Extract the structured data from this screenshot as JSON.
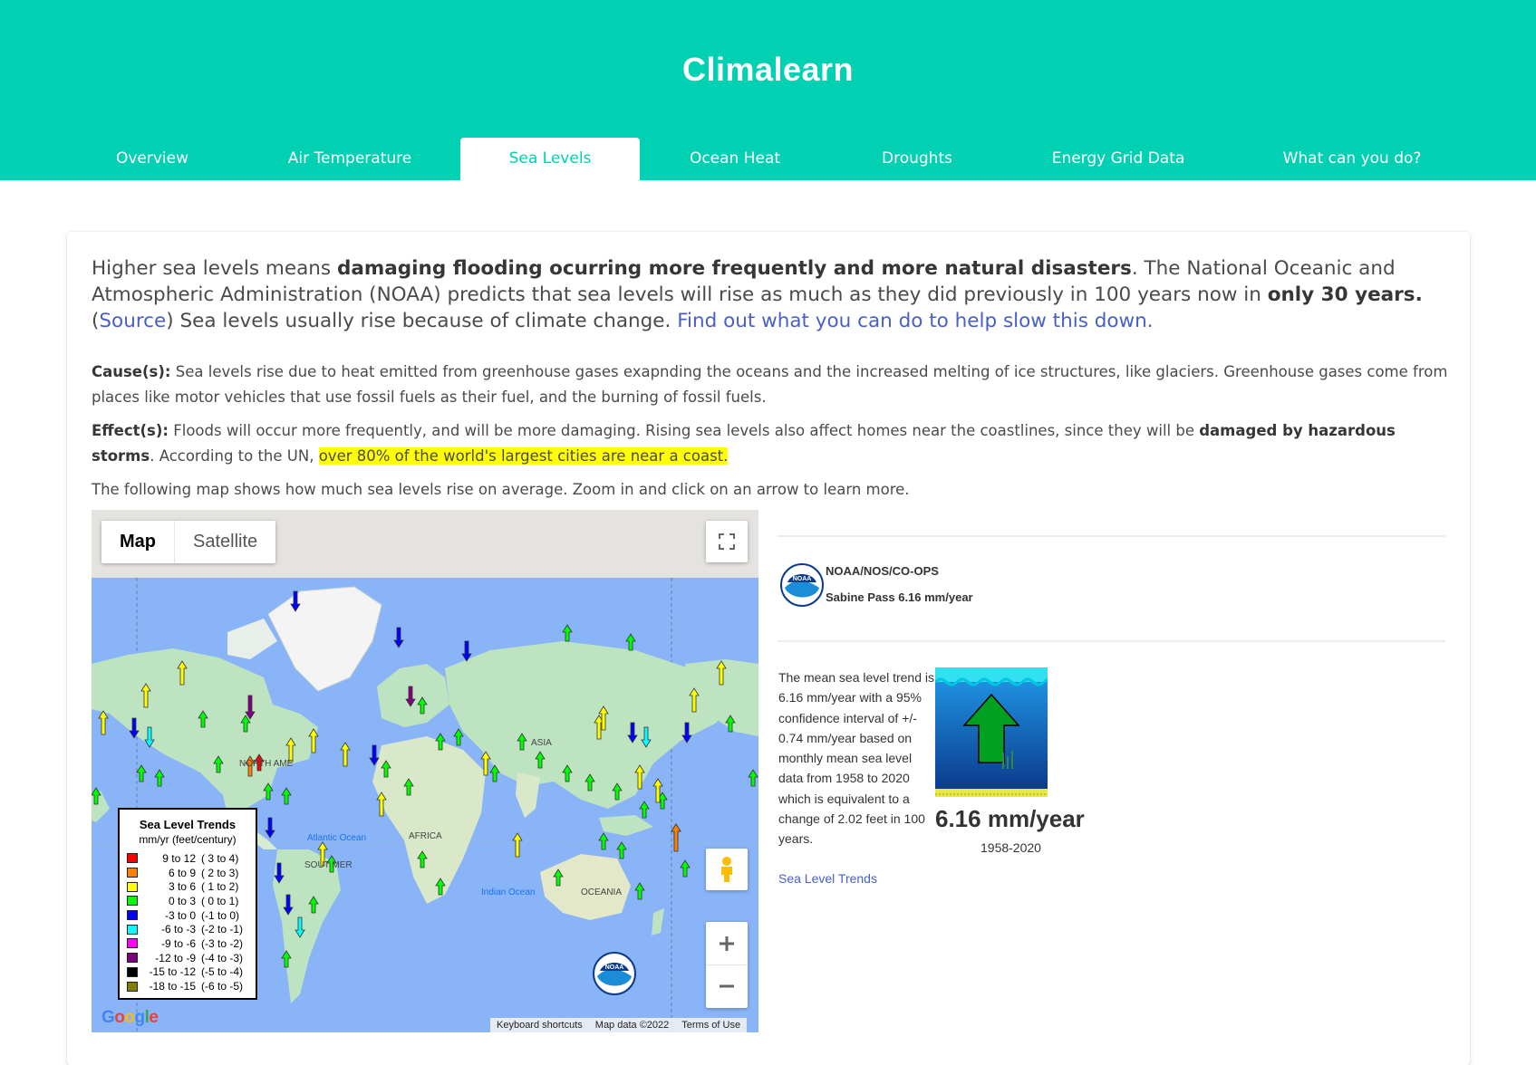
{
  "header": {
    "title": "Climalearn",
    "tabs": [
      {
        "label": "Overview",
        "active": false
      },
      {
        "label": "Air Temperature",
        "active": false
      },
      {
        "label": "Sea Levels",
        "active": true
      },
      {
        "label": "Ocean Heat",
        "active": false
      },
      {
        "label": "Droughts",
        "active": false
      },
      {
        "label": "Energy Grid Data",
        "active": false
      },
      {
        "label": "What can you do?",
        "active": false
      }
    ]
  },
  "lead": {
    "t1": "Higher sea levels means ",
    "b1": "damaging flooding ocurring more frequently and more natural disasters",
    "t2": ". The National Oceanic and Atmospheric Administration (NOAA) predicts that sea levels will rise as much as they did previously in 100 years now in ",
    "b2": "only 30 years.",
    "t3": " (",
    "source_link": "Source",
    "t4": ") Sea levels usually rise because of climate change. ",
    "help_link": "Find out what you can do to help slow this down."
  },
  "causes": {
    "label": "Cause(s):",
    "text": " Sea levels rise due to heat emitted from greenhouse gases exapnding the oceans and the increased melting of ice structures, like glaciers. Greenhouse gases come from places like motor vehicles that use fossil fuels as their fuel, and the burning of fossil fuels."
  },
  "effects": {
    "label": "Effect(s):",
    "t1": " Floods will occur more frequently, and will be more damaging. Rising sea levels also affect homes near the coastlines, since they will be ",
    "b1": "damaged by hazardous storms",
    "t2": ". According to the UN, ",
    "highlight": "over 80% of the world's largest cities are near a coast."
  },
  "map_intro": "The following map shows how much sea levels rise on average. Zoom in and click on an arrow to learn more.",
  "map": {
    "type_map": "Map",
    "type_satellite": "Satellite",
    "labels": {
      "north_america": "NORTH AME",
      "south_america": "SOUT MER",
      "africa": "AFRICA",
      "asia": "ASIA",
      "oceania": "OCEANIA",
      "atlantic": "Atlantic Ocean",
      "indian": "Indian Ocean"
    },
    "legend": {
      "title": "Sea Level Trends",
      "subtitle": "mm/yr (feet/century)",
      "rows": [
        {
          "range": "9 to  12",
          "feet": "( 3 to  4)",
          "color": "#ff0000"
        },
        {
          "range": "6 to   9",
          "feet": "( 2 to  3)",
          "color": "#ff8000"
        },
        {
          "range": "3 to   6",
          "feet": "( 1 to  2)",
          "color": "#ffff00"
        },
        {
          "range": "0 to   3",
          "feet": "( 0 to  1)",
          "color": "#00ff00"
        },
        {
          "range": "-3 to   0",
          "feet": "(-1 to  0)",
          "color": "#0000ff"
        },
        {
          "range": "-6 to  -3",
          "feet": "(-2 to -1)",
          "color": "#00ffff"
        },
        {
          "range": "-9 to  -6",
          "feet": "(-3 to -2)",
          "color": "#ff00ff"
        },
        {
          "range": "-12 to  -9",
          "feet": "(-4 to -3)",
          "color": "#800080"
        },
        {
          "range": "-15 to -12",
          "feet": "(-5 to -4)",
          "color": "#000000"
        },
        {
          "range": "-18 to -15",
          "feet": "(-6 to -5)",
          "color": "#808000"
        }
      ]
    },
    "footer": {
      "shortcuts": "Keyboard shortcuts",
      "data": "Map data ©2022",
      "terms": "Terms of Use"
    },
    "google": "Google",
    "noaa_badge": "NOAA"
  },
  "station": {
    "org": "NOAA/NOS/CO-OPS",
    "name": "Sabine Pass 6.16 mm/year",
    "trend_text": "The mean sea level trend is 6.16 mm/year with a 95% confidence interval of +/- 0.74 mm/year based on monthly mean sea level data from 1958 to 2020 which is equivalent to a change of 2.02 feet in 100 years.",
    "rate": "6.16 mm/year",
    "years": "1958-2020",
    "link": "Sea Level Trends"
  },
  "colors": {
    "brand": "#00d1b2",
    "link": "#485fc7",
    "highlight": "#ffff00",
    "ocean": "#8ab4f8",
    "land": "#bde3c1",
    "arrow_up_green": "#00ff00",
    "arrow_up_yellow": "#ffff00",
    "arrow_down_blue": "#0000ff"
  }
}
